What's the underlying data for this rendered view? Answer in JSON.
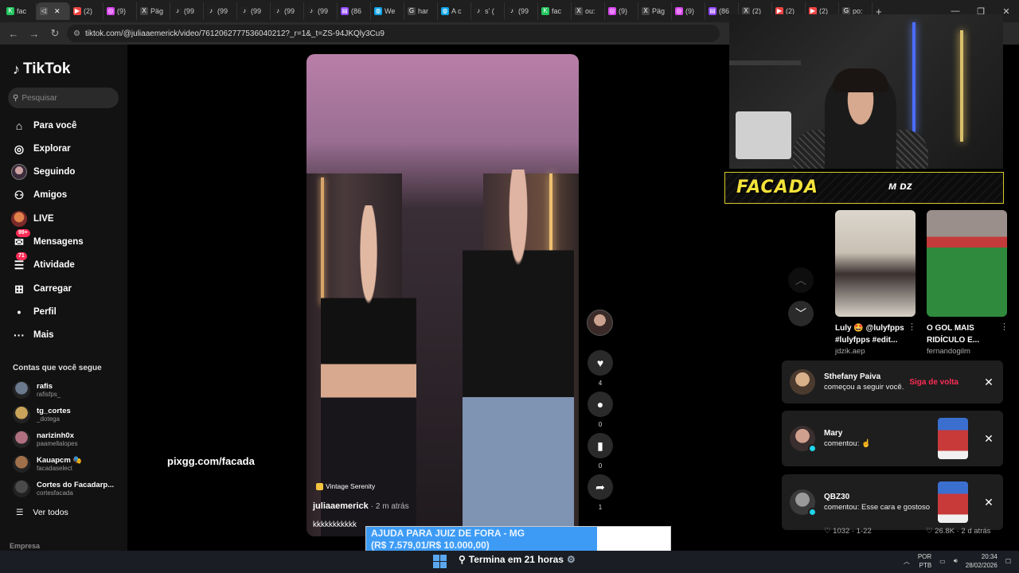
{
  "browser": {
    "tabs": [
      {
        "label": "fac",
        "color": "#22c55e",
        "glyph": "K"
      },
      {
        "label": "",
        "color": "#555555",
        "glyph": "◁",
        "active": true
      },
      {
        "label": "(2)",
        "color": "#ef4444",
        "glyph": "▶"
      },
      {
        "label": "(9)",
        "color": "#d946ef",
        "glyph": "◎"
      },
      {
        "label": "Päg",
        "color": "#444444",
        "glyph": "X"
      },
      {
        "label": "(99",
        "color": "#222222",
        "glyph": "♪"
      },
      {
        "label": "(99",
        "color": "#222222",
        "glyph": "♪"
      },
      {
        "label": "(99",
        "color": "#222222",
        "glyph": "♪"
      },
      {
        "label": "(99",
        "color": "#222222",
        "glyph": "♪"
      },
      {
        "label": "(99",
        "color": "#222222",
        "glyph": "♪"
      },
      {
        "label": "(86",
        "color": "#9146ff",
        "glyph": "▤"
      },
      {
        "label": "We",
        "color": "#0ea5e9",
        "glyph": "◍"
      },
      {
        "label": "har",
        "color": "#444444",
        "glyph": "G"
      },
      {
        "label": "A c",
        "color": "#0ea5e9",
        "glyph": "◍"
      },
      {
        "label": "s' (",
        "color": "#222222",
        "glyph": "♪"
      },
      {
        "label": "(99",
        "color": "#222222",
        "glyph": "♪"
      },
      {
        "label": "fac",
        "color": "#22c55e",
        "glyph": "K"
      },
      {
        "label": "ou:",
        "color": "#444444",
        "glyph": "X"
      },
      {
        "label": "(9)",
        "color": "#d946ef",
        "glyph": "◎"
      },
      {
        "label": "Päg",
        "color": "#444444",
        "glyph": "X"
      },
      {
        "label": "(9)",
        "color": "#d946ef",
        "glyph": "◎"
      },
      {
        "label": "(86",
        "color": "#9146ff",
        "glyph": "▤"
      },
      {
        "label": "(2)",
        "color": "#444444",
        "glyph": "X"
      },
      {
        "label": "(2)",
        "color": "#ef4444",
        "glyph": "▶"
      },
      {
        "label": "(2)",
        "color": "#ef4444",
        "glyph": "▶"
      },
      {
        "label": "po:",
        "color": "#444444",
        "glyph": "G"
      }
    ],
    "new_tab": "+",
    "url": "tiktok.com/@juliaaemerick/video/7612062777536040212?_r=1&_t=ZS-94JKQly3Cu9"
  },
  "sidebar": {
    "brand": "TikTok",
    "search_placeholder": "Pesquisar",
    "nav": [
      {
        "label": "Para você",
        "icon": "⌂",
        "name": "home-icon"
      },
      {
        "label": "Explorar",
        "icon": "◎",
        "name": "compass-icon"
      },
      {
        "label": "Seguindo",
        "icon": "",
        "name": "following-avatar-icon"
      },
      {
        "label": "Amigos",
        "icon": "⚇",
        "name": "friends-icon"
      },
      {
        "label": "LIVE",
        "icon": "",
        "name": "live-avatar-icon"
      },
      {
        "label": "Mensagens",
        "icon": "✉",
        "name": "messages-icon",
        "badge": "99+"
      },
      {
        "label": "Atividade",
        "icon": "☰",
        "name": "activity-icon",
        "badge": "71"
      },
      {
        "label": "Carregar",
        "icon": "⊞",
        "name": "upload-icon"
      },
      {
        "label": "Perfil",
        "icon": "•",
        "name": "profile-icon"
      },
      {
        "label": "Mais",
        "icon": "···",
        "name": "more-icon"
      }
    ],
    "following_title": "Contas que você segue",
    "accounts": [
      {
        "name": "rafis",
        "handle": "rafisfps_",
        "color": "#6b7a8c"
      },
      {
        "name": "tg_cortes",
        "handle": "_dotega",
        "color": "#c9a35a"
      },
      {
        "name": "narizinh0x",
        "handle": "paamellalopes",
        "color": "#b07080"
      },
      {
        "name": "Kauapcm 🎭",
        "handle": "facadaselect",
        "color": "#a0704a"
      },
      {
        "name": "Cortes do Facadarp...",
        "handle": "cortesfacada",
        "color": "#4a4a4a"
      }
    ],
    "see_all": "Ver todos",
    "footer": "Empresa"
  },
  "video": {
    "music": "Vintage Serenity",
    "author": "juliaaemerick",
    "time": "· 2 m atrás",
    "caption": "kkkkkkkkkkk",
    "overlay_text": "pixgg.com/facada"
  },
  "rail": {
    "likes": "4",
    "comments": "0",
    "saves": "0",
    "shares": "1"
  },
  "stream": {
    "banner_text": "FACADA",
    "banner_logo": "ᴍ ᴅᴢ"
  },
  "cards": [
    {
      "title": "Luly 🤩 @lulyfpps #lulyfpps #edit...",
      "user": "jdzik.aep"
    },
    {
      "title": "O GOL MAIS RIDÍCULO E...",
      "user": "fernandogilm"
    }
  ],
  "notifications": [
    {
      "name": "Sthefany Paiva",
      "message": "começou a seguir você.",
      "action": "Siga de volta"
    },
    {
      "name": "Mary",
      "message": "comentou: ☝️"
    },
    {
      "name": "QBZ30",
      "message": "comentou: Esse cara e gostoso"
    }
  ],
  "below_stats": {
    "left": "♡ 1032 · 1-22",
    "right": "♡ 26.8K · 2 d atrás"
  },
  "donation": {
    "line1": "AJUDA PARA JUIZ DE FORA - MG",
    "line2": "(R$ 7.579,01/R$ 10.000,00)",
    "progress_fraction": 0.758
  },
  "taskbar": {
    "search_text": "Termina em 21 horas",
    "lang1": "POR",
    "lang2": "PTB",
    "time": "20:34",
    "date": "28/02/2026"
  }
}
